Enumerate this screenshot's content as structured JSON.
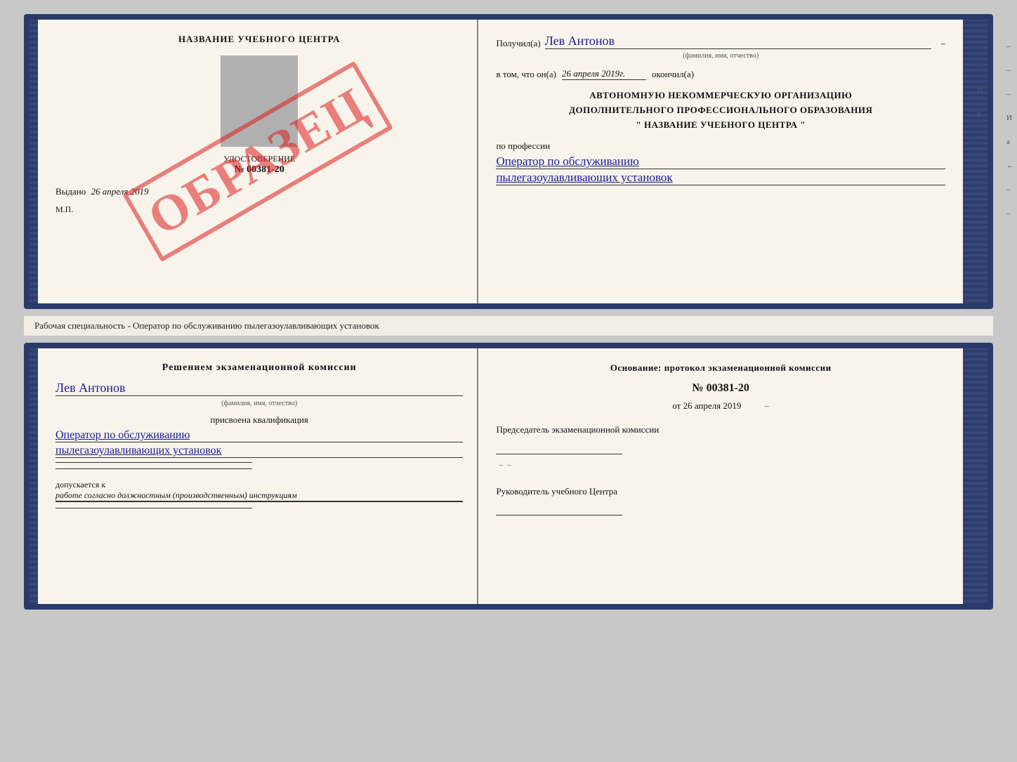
{
  "top_cert": {
    "left": {
      "title": "НАЗВАНИЕ УЧЕБНОГО ЦЕНТРА",
      "doc_type": "УДОСТОВЕРЕНИЕ",
      "doc_number": "№ 00381-20",
      "issued_label": "Выдано",
      "issued_date": "26 апреля 2019",
      "mp_label": "М.П.",
      "watermark": "ОБРАЗЕЦ"
    },
    "right": {
      "recipient_label": "Получил(а)",
      "recipient_name": "Лев Антонов",
      "fio_note": "(фамилия, имя, отчество)",
      "date_prefix": "в том, что он(а)",
      "date_value": "26 апреля 2019г.",
      "completed_label": "окончил(а)",
      "org_line1": "АВТОНОМНУЮ НЕКОММЕРЧЕСКУЮ ОРГАНИЗАЦИЮ",
      "org_line2": "ДОПОЛНИТЕЛЬНОГО ПРОФЕССИОНАЛЬНОГО ОБРАЗОВАНИЯ",
      "org_line3": "\" НАЗВАНИЕ УЧЕБНОГО ЦЕНТРА \"",
      "profession_label": "по профессии",
      "profession_line1": "Оператор по обслуживанию",
      "profession_line2": "пылегазоулавливающих установок"
    }
  },
  "divider": {
    "text": "Рабочая специальность - Оператор по обслуживанию пылегазоулавливающих установок"
  },
  "bottom_cert": {
    "left": {
      "commission_title": "Решением экзаменационной комиссии",
      "name": "Лев Антонов",
      "fio_note": "(фамилия, имя, отчество)",
      "qualification_label": "присвоена квалификация",
      "qualification_line1": "Оператор по обслуживанию",
      "qualification_line2": "пылегазоулавливающих установок",
      "admission_prefix": "допускается к",
      "admission_text": "работе согласно должностным (производственным) инструкциям"
    },
    "right": {
      "basis_label": "Основание: протокол экзаменационной комиссии",
      "protocol_number": "№ 00381-20",
      "protocol_date_prefix": "от",
      "protocol_date": "26 апреля 2019",
      "chairman_label": "Председатель экзаменационной комиссии",
      "center_head_label": "Руководитель учебного Центра"
    }
  },
  "side_marks": [
    "-",
    "И",
    "а",
    "←",
    "-",
    "-",
    "-"
  ]
}
